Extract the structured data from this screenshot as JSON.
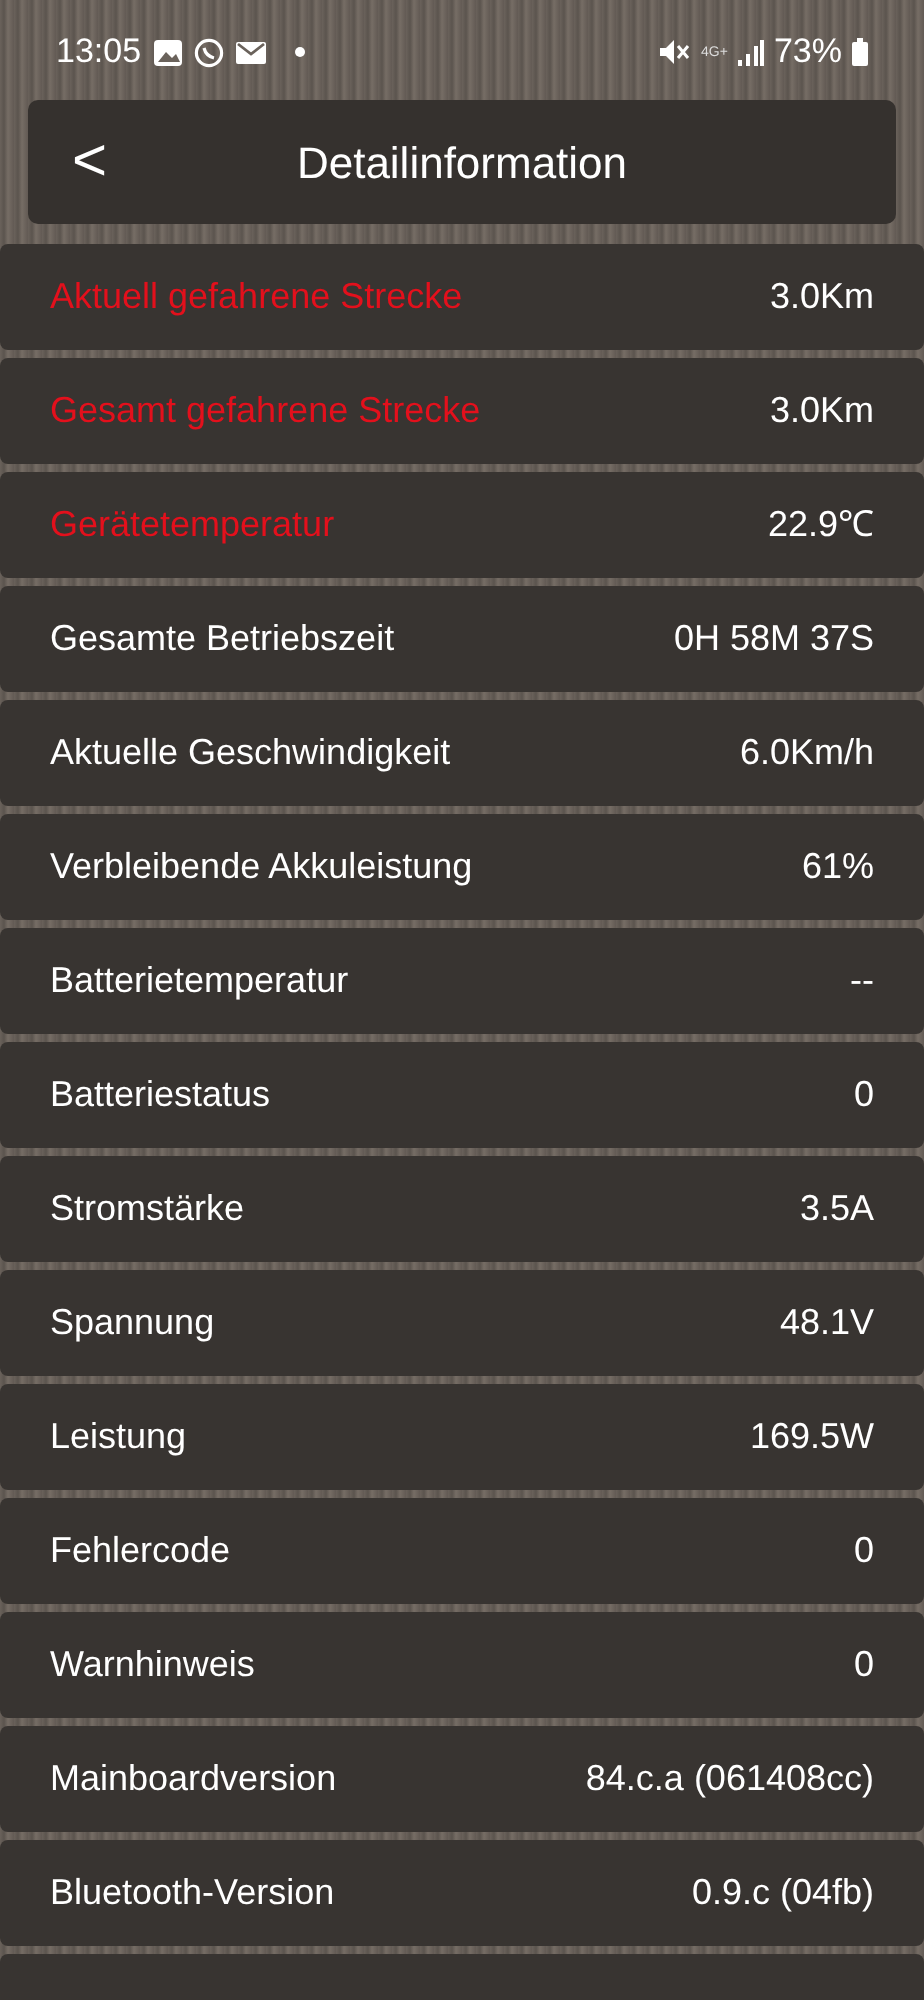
{
  "status_bar": {
    "time": "13:05",
    "battery": "73%",
    "network": "4G+"
  },
  "header": {
    "back": "<",
    "title": "Detailinformation"
  },
  "rows": [
    {
      "label": "Aktuell gefahrene Strecke",
      "value": "3.0Km",
      "alert": true
    },
    {
      "label": "Gesamt gefahrene Strecke",
      "value": "3.0Km",
      "alert": true
    },
    {
      "label": "Gerätetemperatur",
      "value": "22.9℃",
      "alert": true
    },
    {
      "label": "Gesamte Betriebszeit",
      "value": "0H 58M 37S",
      "alert": false
    },
    {
      "label": "Aktuelle Geschwindigkeit",
      "value": "6.0Km/h",
      "alert": false
    },
    {
      "label": "Verbleibende Akkuleistung",
      "value": "61%",
      "alert": false
    },
    {
      "label": "Batterietemperatur",
      "value": "--",
      "alert": false
    },
    {
      "label": "Batteriestatus",
      "value": "0",
      "alert": false
    },
    {
      "label": "Stromstärke",
      "value": "3.5A",
      "alert": false
    },
    {
      "label": "Spannung",
      "value": "48.1V",
      "alert": false
    },
    {
      "label": "Leistung",
      "value": "169.5W",
      "alert": false
    },
    {
      "label": "Fehlercode",
      "value": "0",
      "alert": false
    },
    {
      "label": "Warnhinweis",
      "value": "0",
      "alert": false
    },
    {
      "label": "Mainboardversion",
      "value": "84.c.a (061408cc)",
      "alert": false
    },
    {
      "label": "Bluetooth-Version",
      "value": "0.9.c (04fb)",
      "alert": false
    }
  ]
}
